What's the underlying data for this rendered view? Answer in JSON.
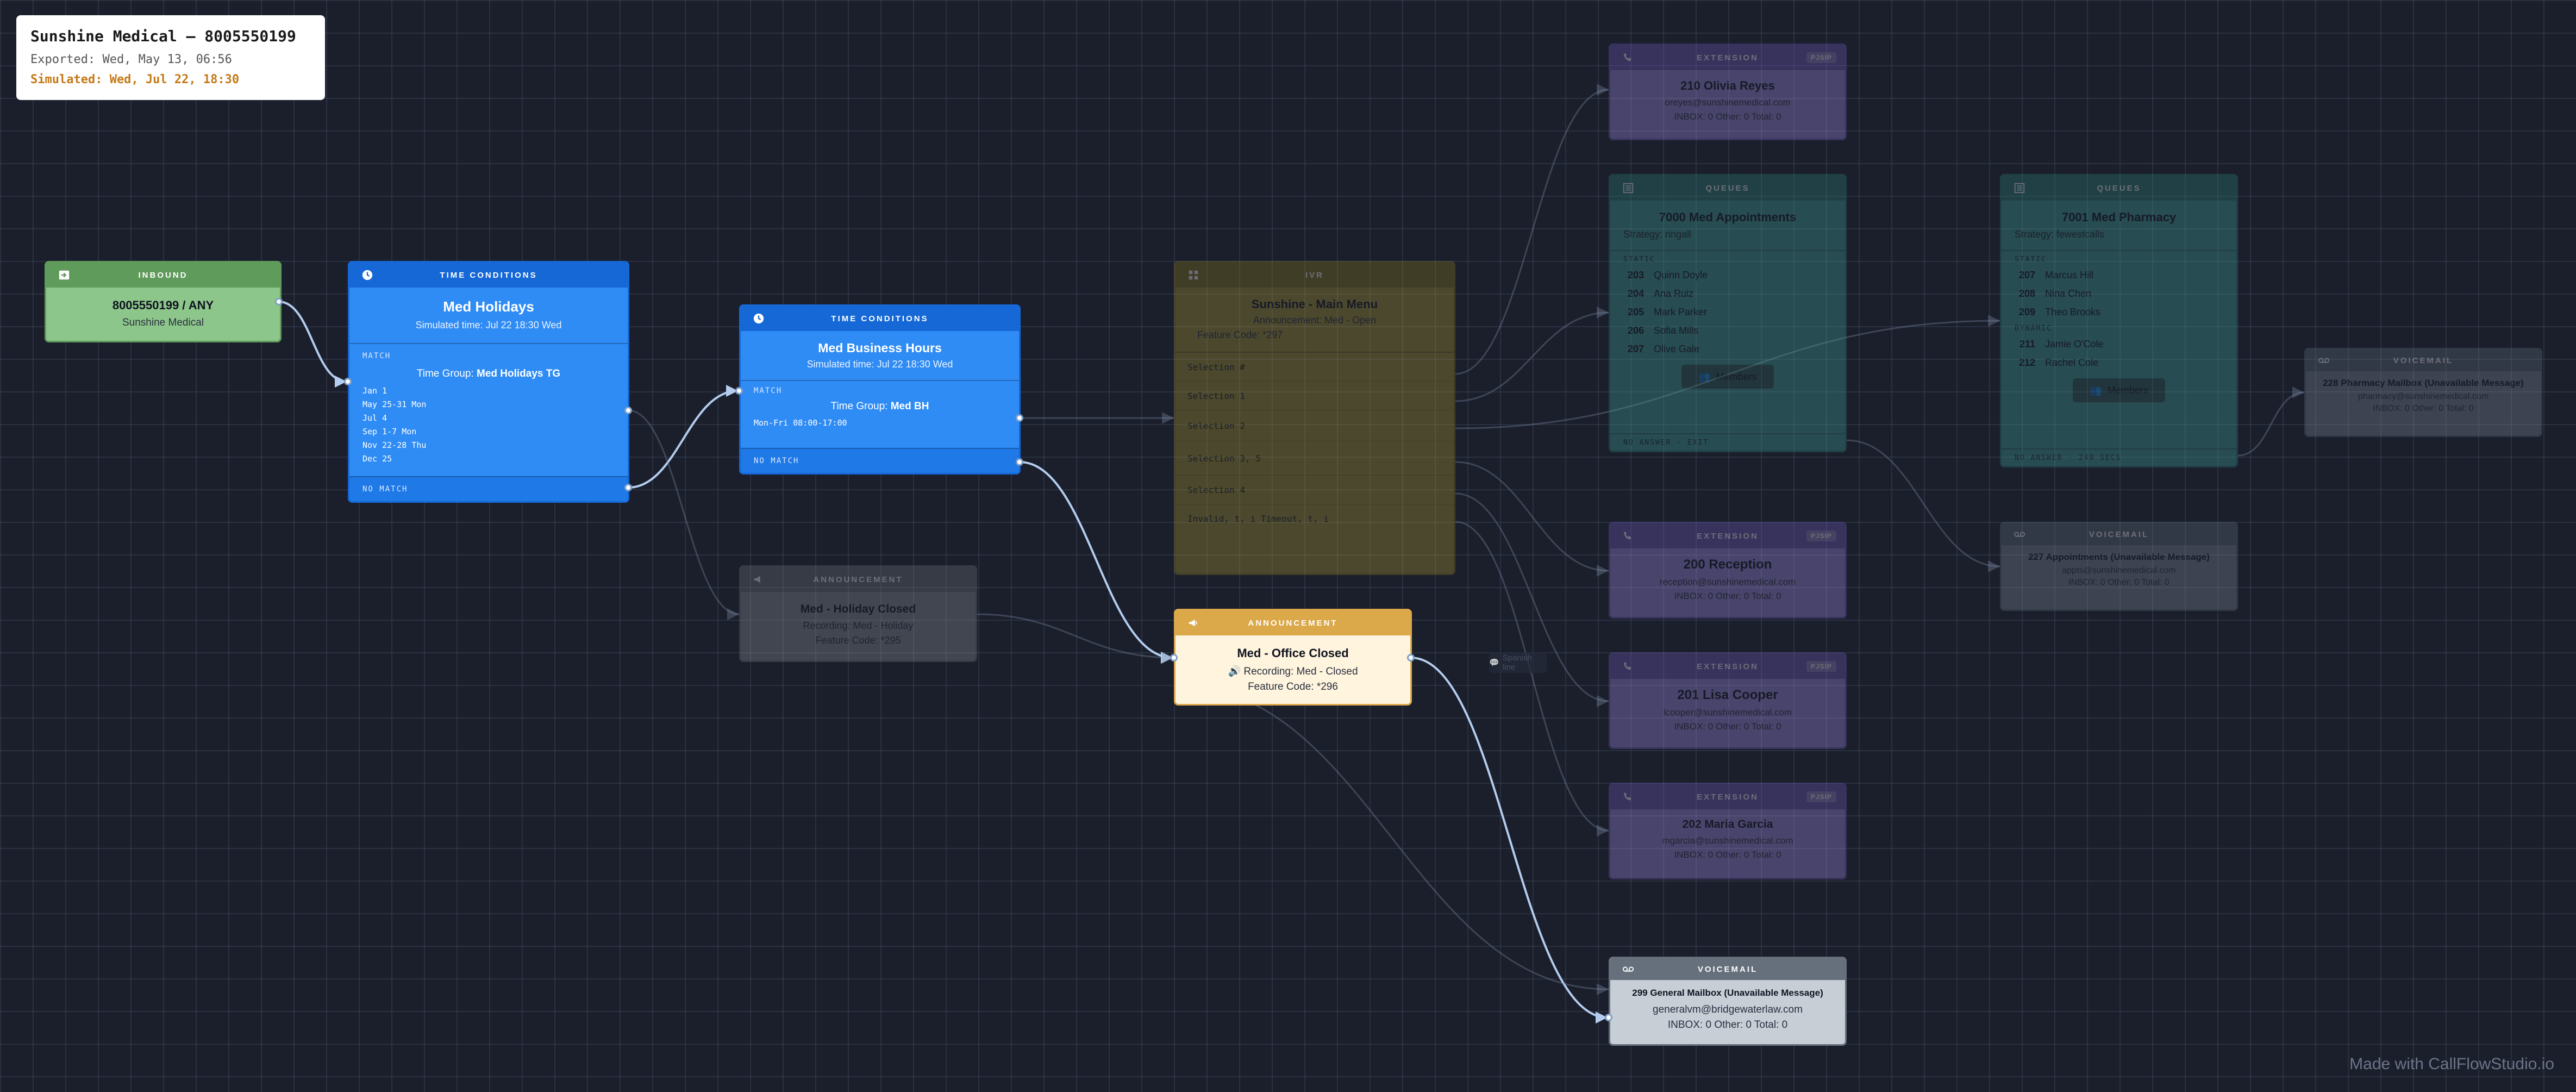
{
  "title_card": {
    "title": "Sunshine Medical — 8005550199",
    "exported": "Exported: Wed, May 13, 06:56",
    "simulated": "Simulated: Wed, Jul 22, 18:30"
  },
  "footer": "Made with CallFlowStudio.io",
  "colors": {
    "inbound": "#5f9b5a",
    "time": "#1e74e8",
    "announcement": "#dba84a",
    "ivr": "#6d6322",
    "extension": "#5a4b8f",
    "queue": "#266e68",
    "voicemail": "#65707c",
    "wire": "#b4cdee"
  },
  "nodes": {
    "inbound": {
      "header": "INBOUND",
      "icon": "sign-in-icon",
      "number": "8005550199 / ANY",
      "name": "Sunshine Medical"
    },
    "tc_holidays": {
      "header": "TIME CONDITIONS",
      "icon": "clock-icon",
      "title": "Med Holidays",
      "simulated": "Simulated time: Jul 22 18:30 Wed",
      "match_label": "MATCH",
      "group_prefix": "Time Group:",
      "group": "Med Holidays TG",
      "dates": [
        "Jan 1",
        "May 25-31 Mon",
        "Jul 4",
        "Sep 1-7 Mon",
        "Nov 22-28 Thu",
        "Dec 25"
      ],
      "nomatch_label": "NO MATCH"
    },
    "tc_business": {
      "header": "TIME CONDITIONS",
      "icon": "clock-icon",
      "title": "Med Business Hours",
      "simulated": "Simulated time: Jul 22 18:30 Wed",
      "match_label": "MATCH",
      "group_prefix": "Time Group:",
      "group": "Med BH",
      "hours": "Mon-Fri 08:00-17:00",
      "nomatch_label": "NO MATCH"
    },
    "ann_holiday": {
      "header": "ANNOUNCEMENT",
      "icon": "megaphone-icon",
      "title": "Med - Holiday Closed",
      "recording": "Recording: Med - Holiday",
      "feature": "Feature Code: *295"
    },
    "ivr": {
      "header": "IVR",
      "icon": "grid-icon",
      "title": "Sunshine - Main Menu",
      "announcement": "Announcement: Med - Open",
      "feature": "Feature Code: *297",
      "options": [
        "Selection #",
        "Selection 1",
        "Selection 2",
        "Selection 3, 5",
        "Selection 4",
        "Invalid, t, i Timeout, t, i"
      ]
    },
    "ann_closed": {
      "header": "ANNOUNCEMENT",
      "icon": "megaphone-icon",
      "title": "Med - Office Closed",
      "recording": "Recording: Med - Closed",
      "feature": "Feature Code: *296"
    },
    "ext_210": {
      "header": "EXTENSION",
      "badge": "PJSIP",
      "icon": "phone-icon",
      "title": "210 Olivia Reyes",
      "email": "oreyes@sunshinemedical.com",
      "stats": "INBOX: 0 Other: 0 Total: 0"
    },
    "queue_7000": {
      "header": "QUEUES",
      "icon": "queue-icon",
      "title": "7000 Med Appointments",
      "strategy": "Strategy: ringall",
      "members_label": "Static",
      "members": [
        {
          "num": "203",
          "name": "Quinn Doyle"
        },
        {
          "num": "204",
          "name": "Ana Ruiz"
        },
        {
          "num": "205",
          "name": "Mark Parker"
        },
        {
          "num": "206",
          "name": "Sofia Mills"
        },
        {
          "num": "207",
          "name": "Olive Gale"
        }
      ],
      "button": "Members",
      "footer": "NO ANSWER · EXIT"
    },
    "queue_7001": {
      "header": "QUEUES",
      "icon": "queue-icon",
      "title": "7001 Med Pharmacy",
      "strategy": "Strategy: fewestcalls",
      "members_label": "Static",
      "members": [
        {
          "num": "207",
          "name": "Marcus Hill"
        },
        {
          "num": "208",
          "name": "Nina Chen"
        },
        {
          "num": "209",
          "name": "Theo Brooks"
        }
      ],
      "dynamic_label": "Dynamic",
      "dynamic": [
        {
          "num": "211",
          "name": "Jamie O'Cole"
        },
        {
          "num": "212",
          "name": "Rachel Cole"
        }
      ],
      "button": "Members",
      "footer": "NO ANSWER · 240 SECS"
    },
    "vm_pharmacy": {
      "header": "VOICEMAIL",
      "icon": "voicemail-icon",
      "title": "228 Pharmacy Mailbox (Unavailable Message)",
      "email": "pharmacy@sunshinemedical.com",
      "stats": "INBOX: 0 Other: 0 Total: 0"
    },
    "ext_200": {
      "header": "EXTENSION",
      "badge": "PJSIP",
      "icon": "phone-icon",
      "title": "200 Reception",
      "email": "reception@sunshinemedical.com",
      "stats": "INBOX: 0 Other: 0 Total: 0"
    },
    "vm_appt": {
      "header": "VOICEMAIL",
      "icon": "voicemail-icon",
      "title": "227 Appointments (Unavailable Message)",
      "email": "appts@sunshinemedical.com",
      "stats": "INBOX: 0 Other: 0 Total: 0"
    },
    "ext_201": {
      "header": "EXTENSION",
      "badge": "PJSIP",
      "icon": "phone-icon",
      "title": "201 Lisa Cooper",
      "email": "lcooper@sunshinemedical.com",
      "stats": "INBOX: 0 Other: 0 Total: 0"
    },
    "ext_202": {
      "header": "EXTENSION",
      "badge": "PJSIP",
      "icon": "phone-icon",
      "title": "202 Maria Garcia",
      "email": "mgarcia@sunshinemedical.com",
      "stats": "INBOX: 0 Other: 0 Total: 0"
    },
    "vm_general": {
      "header": "VOICEMAIL",
      "icon": "voicemail-icon",
      "title": "299 General Mailbox (Unavailable Message)",
      "email": "generalvm@bridgewaterlaw.com",
      "stats": "INBOX: 0 Other: 0 Total: 0"
    }
  },
  "spanish_label": "Spanish line"
}
